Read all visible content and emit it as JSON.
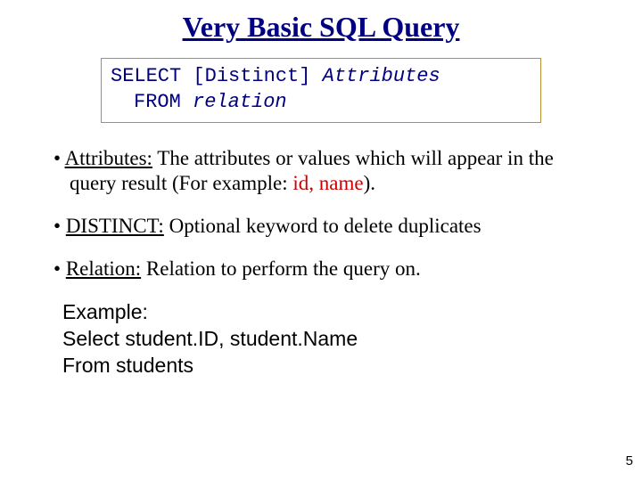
{
  "title": "Very Basic SQL Query",
  "code": {
    "kw_select": "SELECT",
    "distinct": "[Distinct]",
    "attrs": "Attributes",
    "kw_from": "FROM",
    "relation": "relation"
  },
  "bullets": {
    "b1_term": "Attributes:",
    "b1_text1": " The attributes or values which will appear in the query result (For example: ",
    "b1_highlight": "id, name",
    "b1_text2": ").",
    "b2_term": "DISTINCT:",
    "b2_text": " Optional keyword to delete duplicates",
    "b3_term": "Relation:",
    "b3_text": " Relation to perform the query on."
  },
  "example": {
    "label": "Example:",
    "line1": "Select student.ID, student.Name",
    "line2": "From students"
  },
  "page_number": "5"
}
